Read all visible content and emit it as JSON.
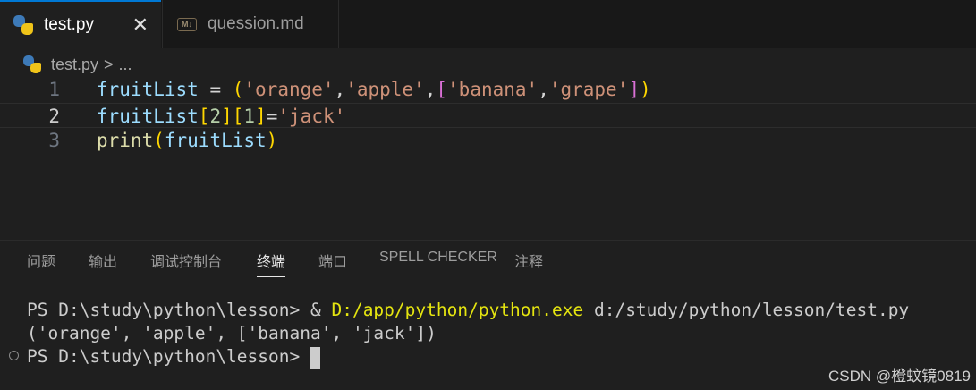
{
  "tabs": [
    {
      "label": "test.py",
      "icon": "python-icon",
      "active": true,
      "close": "✕"
    },
    {
      "label": "quession.md",
      "icon": "markdown-icon",
      "active": false,
      "icon_text": "M↓"
    }
  ],
  "breadcrumb": {
    "file": "test.py",
    "separator": ">",
    "rest": "..."
  },
  "editor": {
    "lines": [
      {
        "number": "1",
        "text": "fruitList = ('orange','apple',['banana','grape'])"
      },
      {
        "number": "2",
        "text": "fruitList[2][1]='jack'"
      },
      {
        "number": "3",
        "text": "print(fruitList)"
      }
    ],
    "current_line": "2"
  },
  "panel": {
    "tabs": [
      "问题",
      "输出",
      "调试控制台",
      "终端",
      "端口",
      "SPELL CHECKER",
      "注释"
    ],
    "active_tab": "终端"
  },
  "terminal": {
    "line1_prompt": "PS D:\\study\\python\\lesson> ",
    "line1_amp": "& ",
    "line1_exe": "D:/app/python/python.exe",
    "line1_arg": " d:/study/python/lesson/test.py",
    "line2": "('orange', 'apple', ['banana', 'jack'])",
    "line3_prompt": "PS D:\\study\\python\\lesson> "
  },
  "watermark": "CSDN @橙蚊镜0819",
  "colors": {
    "accent": "#0078d4",
    "background": "#1f1f1f",
    "terminal_exe": "#e5e510"
  }
}
